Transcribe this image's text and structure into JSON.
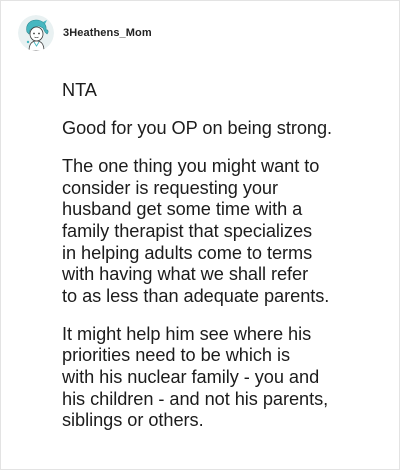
{
  "comment": {
    "username": "3Heathens_Mom",
    "paragraphs": [
      "NTA",
      "Good for you OP on being strong.",
      "The one thing you might want to\nconsider is requesting your\nhusband get some time with a\nfamily therapist that specializes\nin helping adults come to terms\nwith having what we shall refer\nto as less than adequate parents.",
      "It might help him see where his\npriorities need to be which is\nwith his nuclear family - you and\nhis children - and not his parents,\nsiblings or others."
    ]
  },
  "colors": {
    "avatar_background": "#e9f1f2",
    "avatar_accent": "#47b7c0",
    "avatar_outline": "#3a3a3a"
  }
}
